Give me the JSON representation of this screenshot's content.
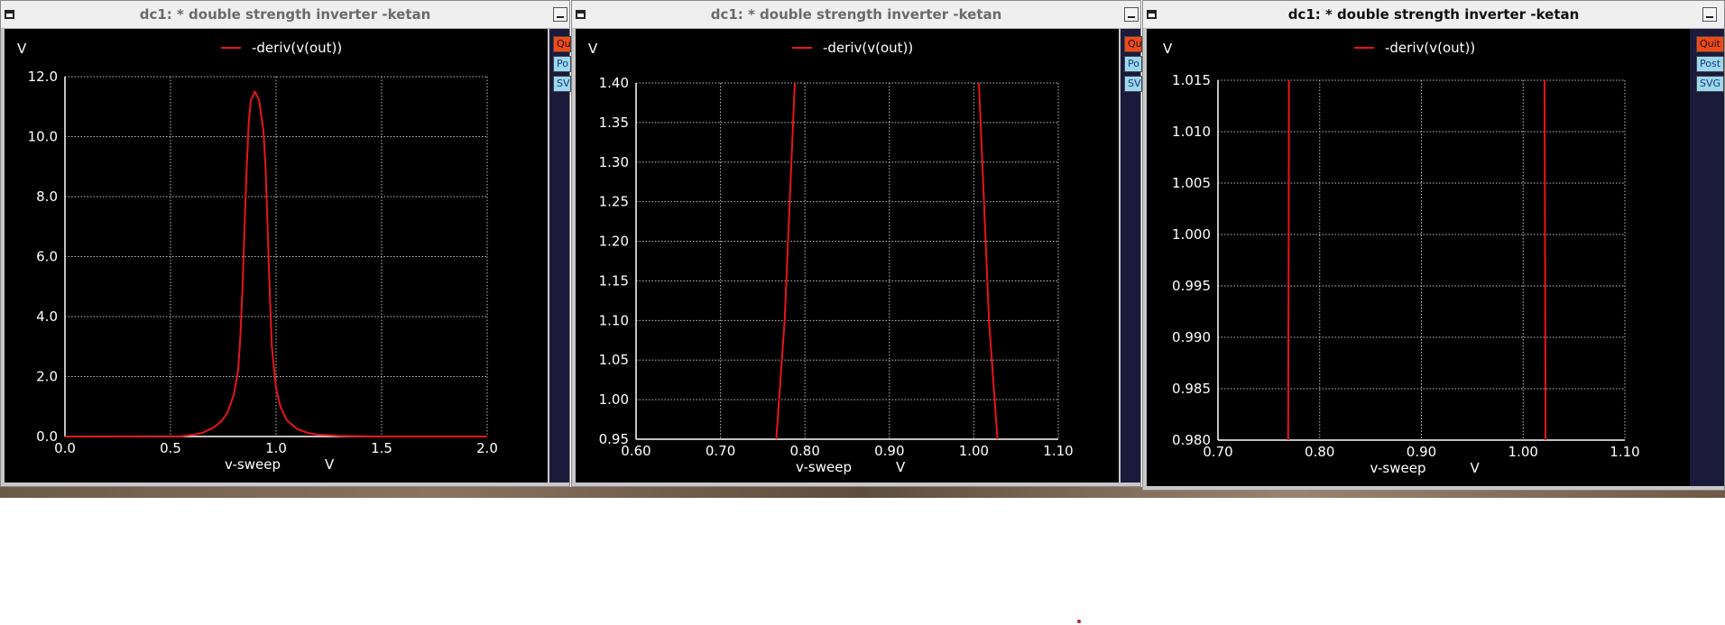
{
  "windows": [
    {
      "title": "dc1: * double strength inverter -ketan",
      "active": false,
      "buttons": {
        "quit": "Qu",
        "post": "Po",
        "svg": "SV"
      },
      "chart_data": {
        "type": "line",
        "ylabel": "V",
        "xlabel": "v-sweep",
        "xunit": "V",
        "xlim": [
          0.0,
          2.0
        ],
        "ylim": [
          0.0,
          12.0
        ],
        "xticks": [
          "0.0",
          "0.5",
          "1.0",
          "1.5",
          "2.0"
        ],
        "yticks": [
          "0.0",
          "2.0",
          "4.0",
          "6.0",
          "8.0",
          "10.0",
          "12.0"
        ],
        "grid": true,
        "legend": "top-center",
        "series": [
          {
            "name": "-deriv(v(out))",
            "color": "#e8141c",
            "x": [
              0.0,
              0.55,
              0.6,
              0.65,
              0.7,
              0.74,
              0.77,
              0.8,
              0.82,
              0.83,
              0.84,
              0.85,
              0.86,
              0.87,
              0.88,
              0.9,
              0.92,
              0.93,
              0.94,
              0.95,
              0.96,
              0.97,
              0.98,
              1.0,
              1.02,
              1.05,
              1.1,
              1.15,
              1.2,
              1.3,
              1.5,
              2.0
            ],
            "y": [
              0.0,
              0.01,
              0.05,
              0.12,
              0.28,
              0.5,
              0.8,
              1.4,
              2.2,
              3.2,
              4.8,
              6.8,
              8.8,
              10.4,
              11.2,
              11.5,
              11.2,
              10.7,
              10.2,
              9.0,
              7.0,
              4.8,
              3.0,
              1.6,
              1.0,
              0.55,
              0.25,
              0.12,
              0.06,
              0.02,
              0.0,
              0.0
            ]
          }
        ]
      }
    },
    {
      "title": "dc1: * double strength inverter -ketan",
      "active": false,
      "buttons": {
        "quit": "Qu",
        "post": "Po",
        "svg": "SV"
      },
      "chart_data": {
        "type": "line",
        "ylabel": "V",
        "xlabel": "v-sweep",
        "xunit": "V",
        "xlim": [
          0.6,
          1.1
        ],
        "ylim": [
          0.95,
          1.4
        ],
        "xticks": [
          "0.60",
          "0.70",
          "0.80",
          "0.90",
          "1.00",
          "1.10"
        ],
        "yticks": [
          "0.95",
          "1.00",
          "1.05",
          "1.10",
          "1.15",
          "1.20",
          "1.25",
          "1.30",
          "1.35",
          "1.40"
        ],
        "grid": true,
        "legend": "top-center",
        "series": [
          {
            "name": "-deriv(v(out))",
            "color": "#e8141c",
            "segments": [
              {
                "x": [
                  0.766,
                  0.776,
                  0.784,
                  0.788
                ],
                "y": [
                  0.95,
                  1.1,
                  1.3,
                  1.4
                ]
              },
              {
                "x": [
                  1.006,
                  1.01,
                  1.018,
                  1.028
                ],
                "y": [
                  1.4,
                  1.3,
                  1.1,
                  0.95
                ]
              }
            ]
          }
        ]
      }
    },
    {
      "title": "dc1: * double strength inverter -ketan",
      "active": true,
      "buttons": {
        "quit": "Quit",
        "post": "Post",
        "svg": "SVG"
      },
      "chart_data": {
        "type": "line",
        "ylabel": "V",
        "xlabel": "v-sweep",
        "xunit": "V",
        "xlim": [
          0.7,
          1.1
        ],
        "ylim": [
          0.98,
          1.015
        ],
        "xticks": [
          "0.70",
          "0.80",
          "0.90",
          "1.00",
          "1.10"
        ],
        "yticks": [
          "0.980",
          "0.985",
          "0.990",
          "0.995",
          "1.000",
          "1.005",
          "1.010",
          "1.015"
        ],
        "grid": true,
        "legend": "top-center",
        "series": [
          {
            "name": "-deriv(v(out))",
            "color": "#e8141c",
            "segments": [
              {
                "x": [
                  0.769,
                  0.7695,
                  0.7698
                ],
                "y": [
                  0.98,
                  1.0,
                  1.015
                ]
              },
              {
                "x": [
                  1.021,
                  1.0215,
                  1.022
                ],
                "y": [
                  1.015,
                  1.0,
                  0.98
                ]
              }
            ]
          }
        ]
      }
    }
  ]
}
